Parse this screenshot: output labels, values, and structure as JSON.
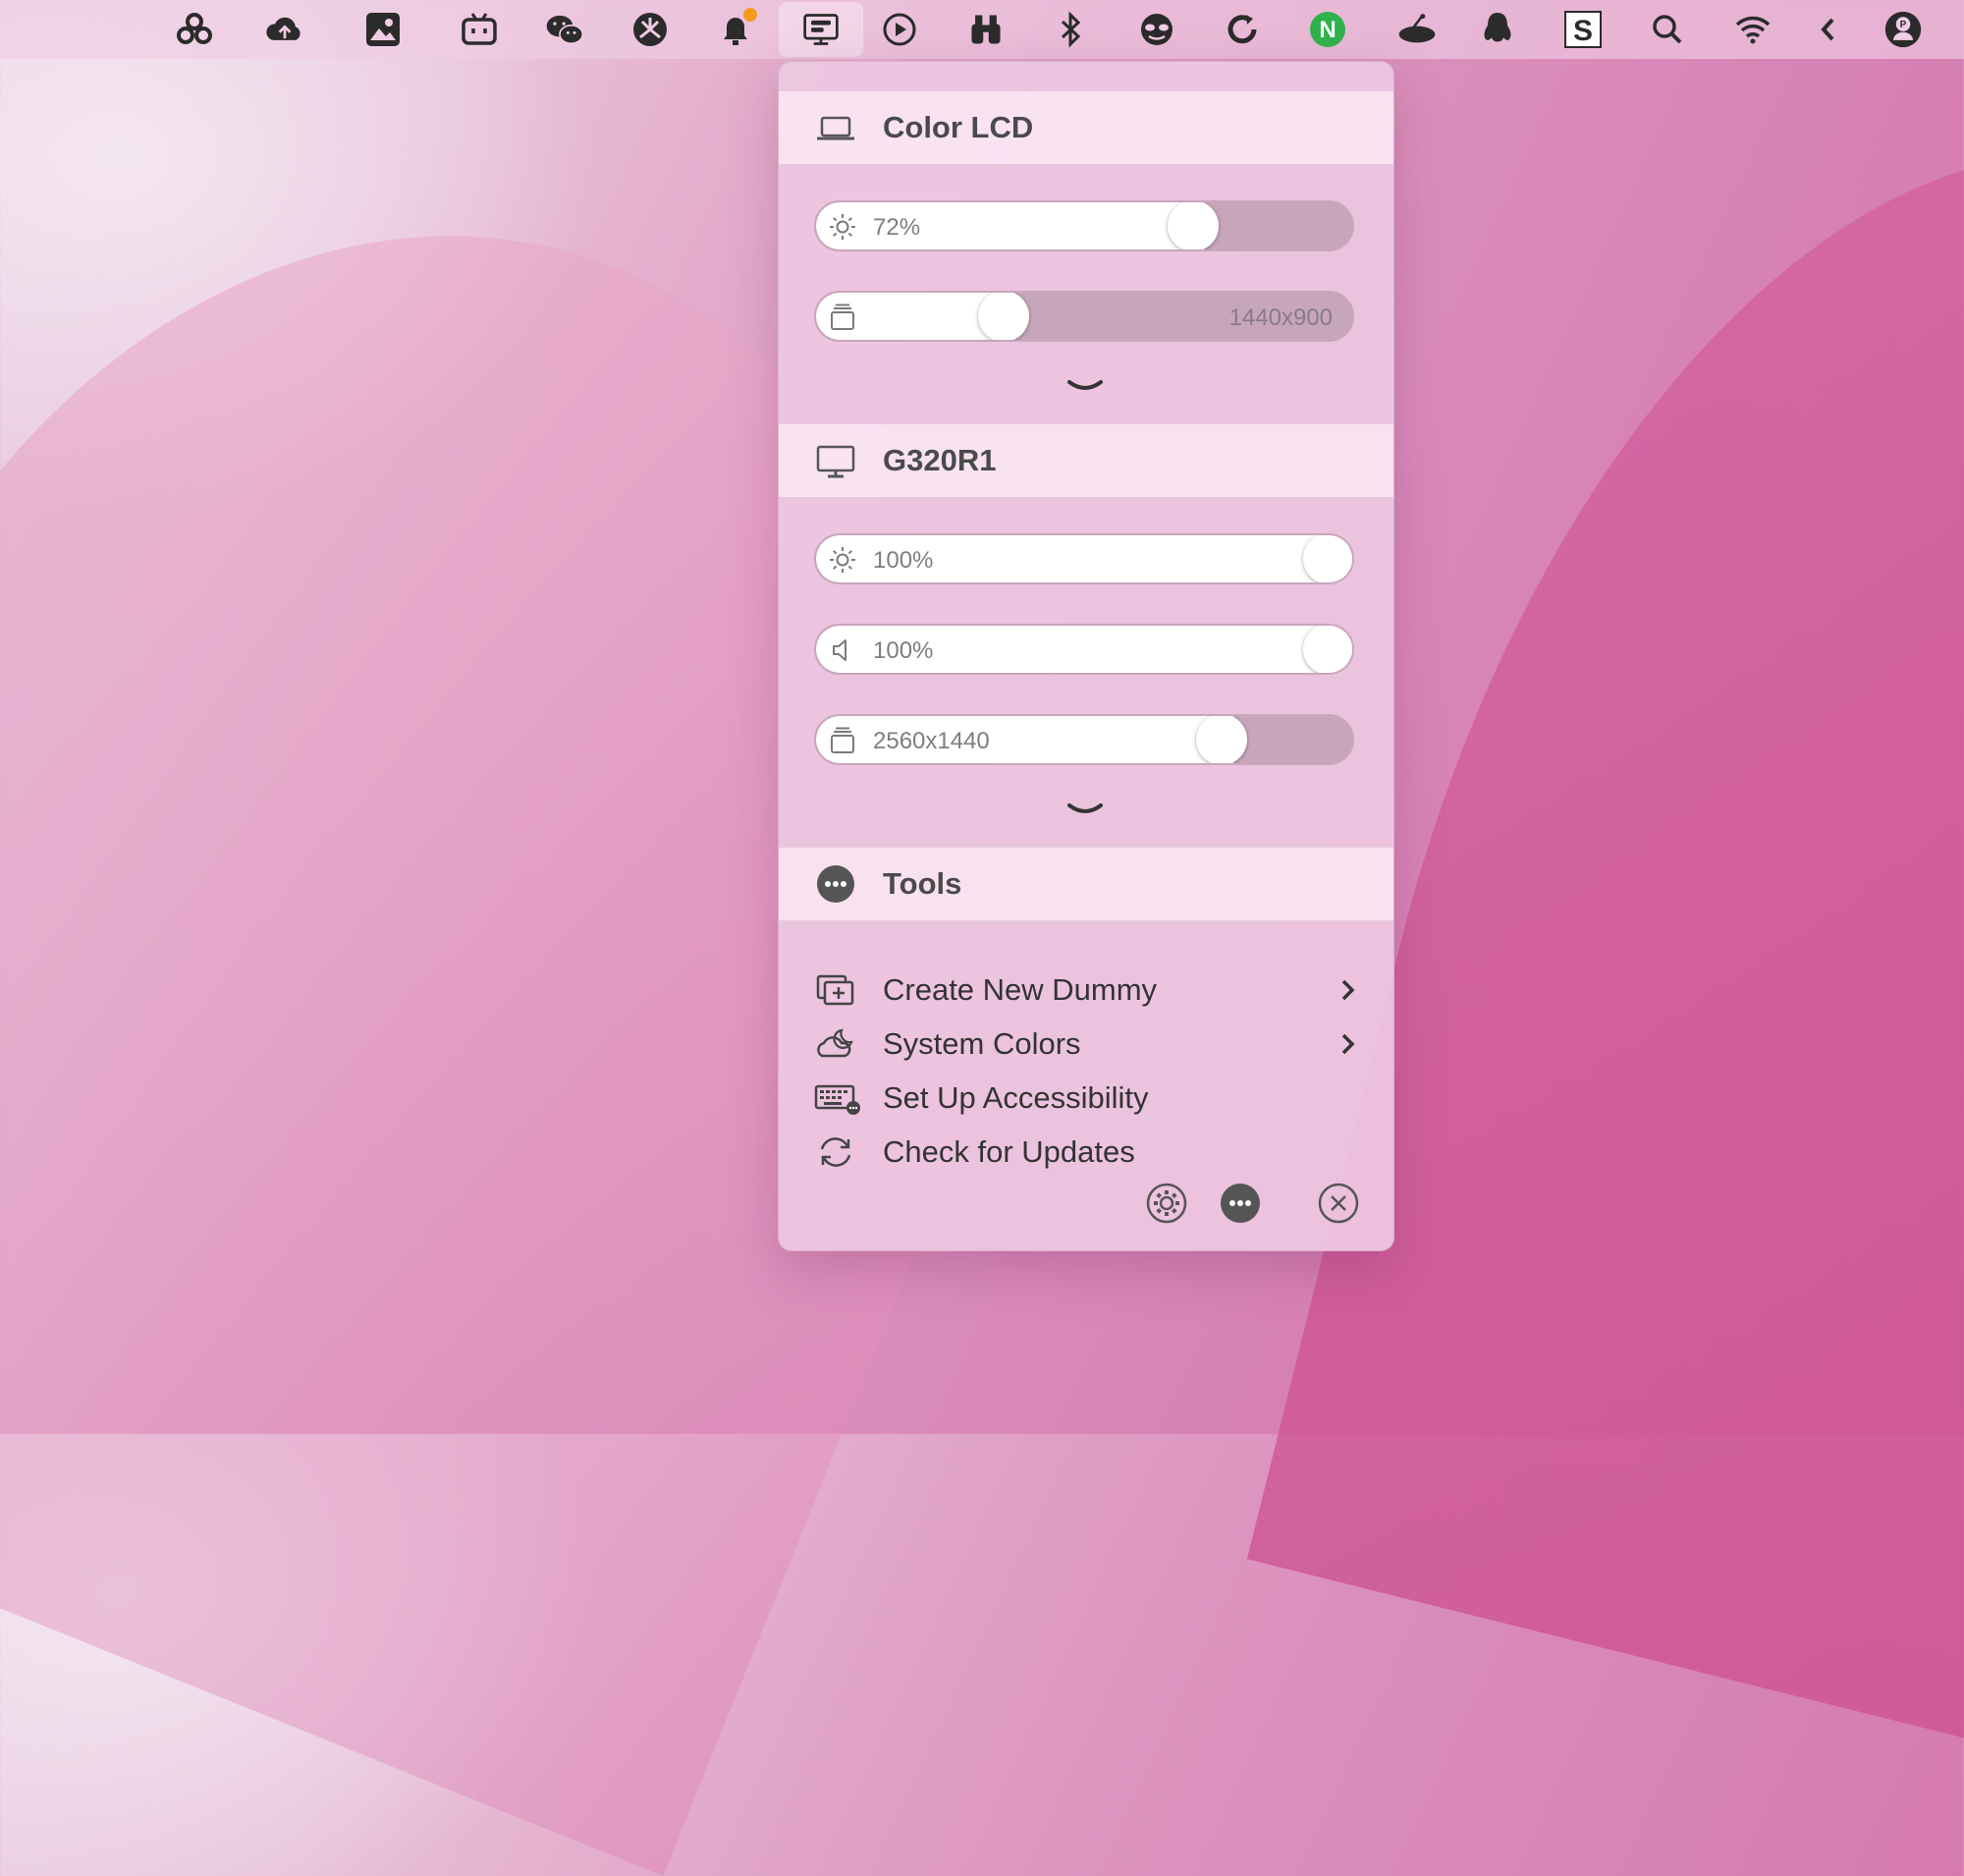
{
  "menubar": {
    "icons": [
      "cloud-clover-icon",
      "cloud-upload-icon",
      "photos-icon",
      "bilibili-icon",
      "wechat-icon",
      "yuque-icon",
      "notification-bell-icon",
      "display-control-icon",
      "play-circle-icon",
      "binoculars-icon",
      "bluetooth-icon",
      "mask-face-icon",
      "sync-circle-icon",
      "n-badge-icon",
      "ufo-icon",
      "qq-penguin-icon",
      "s-app-icon",
      "search-icon",
      "wifi-icon",
      "chevron-left-icon",
      "user-avatar-icon"
    ],
    "n_badge_text": "N",
    "s_text": "S",
    "avatar_text": "P"
  },
  "panel": {
    "displays": [
      {
        "name": "Color LCD",
        "icon": "laptop-icon",
        "brightness": {
          "label": "72%",
          "value": 0.72
        },
        "resolution": {
          "label": "1440x900",
          "value": 0.35
        }
      },
      {
        "name": "G320R1",
        "icon": "monitor-icon",
        "brightness": {
          "label": "100%",
          "value": 1.0
        },
        "volume": {
          "label": "100%",
          "value": 1.0
        },
        "resolution": {
          "label": "2560x1440",
          "value": 0.77
        }
      }
    ],
    "tools": {
      "title": "Tools",
      "items": [
        {
          "label": "Create New Dummy",
          "has_submenu": true
        },
        {
          "label": "System Colors",
          "has_submenu": true
        },
        {
          "label": "Set Up Accessibility",
          "has_submenu": false
        },
        {
          "label": "Check for Updates",
          "has_submenu": false
        }
      ]
    }
  },
  "colors": {
    "accent_dot": "#f39c1c",
    "n_badge": "#2fb24c"
  }
}
